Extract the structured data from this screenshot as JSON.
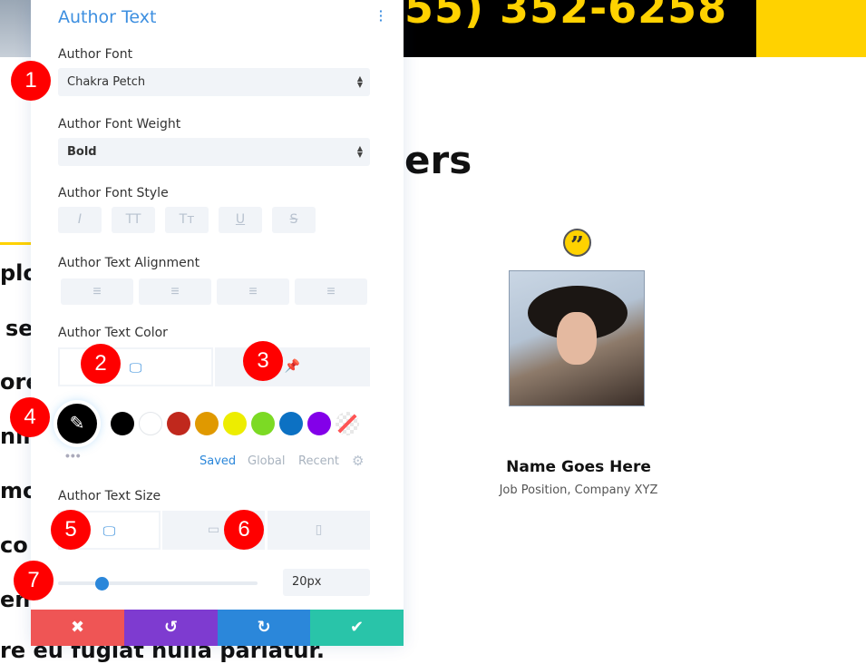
{
  "background_page": {
    "phone": "55) 352-6258",
    "heading": "ers",
    "left_fragments": [
      "plo",
      "se",
      "ore",
      "nim",
      "mo",
      "co",
      "en"
    ],
    "bottom_text": "re eu fugiat nulla pariatur.",
    "testimonial": {
      "name": "Name Goes Here",
      "job_position": "Job Position",
      "company": ", Company XYZ"
    }
  },
  "panel": {
    "title": "Author Text",
    "author_font": {
      "label": "Author Font",
      "value": "Chakra Petch"
    },
    "author_font_weight": {
      "label": "Author Font Weight",
      "value": "Bold"
    },
    "author_font_style": {
      "label": "Author Font Style",
      "buttons": [
        "I",
        "TT",
        "Tт",
        "U",
        "S"
      ]
    },
    "author_text_alignment": {
      "label": "Author Text Alignment",
      "buttons": [
        "left",
        "center",
        "right",
        "justify"
      ]
    },
    "author_text_color": {
      "label": "Author Text Color",
      "current": "#000000",
      "swatches": [
        "#000000",
        "#ffffff",
        "#c0281d",
        "#e09900",
        "#eded00",
        "#7cda24",
        "#0c71c3",
        "#8300e9",
        "transparent"
      ],
      "palette_tabs": [
        "Saved",
        "Global",
        "Recent"
      ],
      "active_palette": "Saved"
    },
    "author_text_size": {
      "label": "Author Text Size",
      "value": "20px",
      "slider_percent": 22,
      "devices": [
        "desktop",
        "tablet",
        "phone"
      ],
      "active_device": "desktop"
    },
    "footer": {
      "cancel": "✖",
      "undo": "↺",
      "redo": "↻",
      "save": "✔"
    },
    "colors": {
      "cancel": "#ef5555",
      "undo": "#7e3bd0",
      "redo": "#2b87da",
      "save": "#29c4a9",
      "accent": "#2b87da"
    }
  },
  "badges": [
    "1",
    "2",
    "3",
    "4",
    "5",
    "6",
    "7"
  ]
}
